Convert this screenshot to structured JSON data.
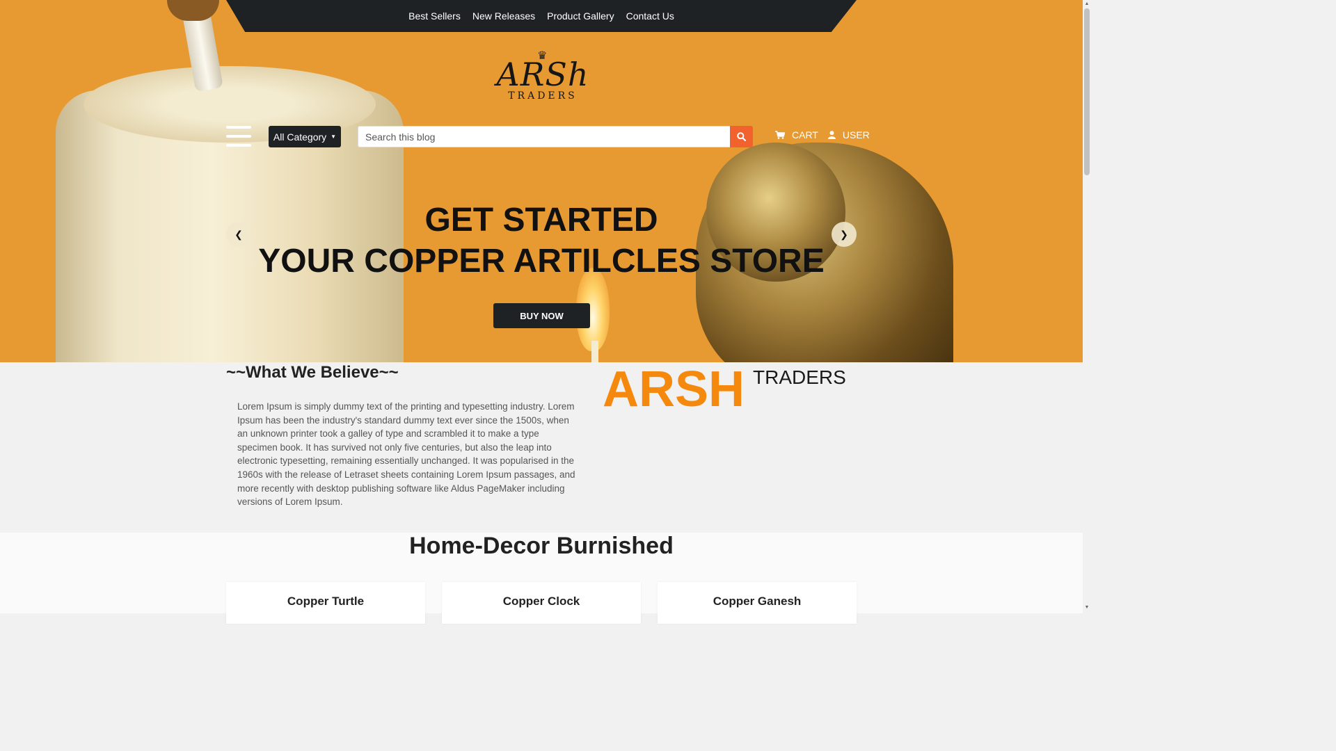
{
  "nav": {
    "links": [
      "Best Sellers",
      "New Releases",
      "Product Gallery",
      "Contact Us"
    ]
  },
  "logo": {
    "main": "ARSh",
    "sub": "TRADERS"
  },
  "search": {
    "category_label": "All Category",
    "placeholder": "Search this blog",
    "button_icon": "search-icon"
  },
  "user_nav": {
    "cart_label": "CART",
    "user_label": "USER"
  },
  "hero": {
    "title_line1": "GET STARTED",
    "title_line2": "YOUR COPPER ARTILCLES STORE",
    "button_label": "BUY NOW"
  },
  "believe": {
    "title": "~~What We Believe~~",
    "text": "Lorem Ipsum is simply dummy text of the printing and typesetting industry. Lorem Ipsum has been the industry's standard dummy text ever since the 1500s, when an unknown printer took a galley of type and scrambled it to make a type specimen book. It has survived not only five centuries, but also the leap into electronic typesetting, remaining essentially unchanged. It was popularised in the 1960s with the release of Letraset sheets containing Lorem Ipsum passages, and more recently with desktop publishing software like Aldus PageMaker including versions of Lorem Ipsum.",
    "brand_big": "ARSH",
    "brand_small": "TRADERS"
  },
  "decor": {
    "title": "Home-Decor Burnished",
    "products": [
      {
        "name": "Copper Turtle"
      },
      {
        "name": "Copper Clock"
      },
      {
        "name": "Copper Ganesh"
      }
    ]
  },
  "colors": {
    "accent": "#f2622e",
    "hero_bg": "#e89a32",
    "brand_orange": "#f5890d",
    "dark": "#1f2224"
  }
}
